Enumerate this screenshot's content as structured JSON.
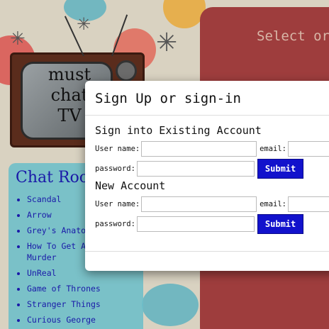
{
  "logo": {
    "line1": "must",
    "line2": "chat",
    "line3": "TV"
  },
  "rooms": {
    "title": "Chat Rooms",
    "items": [
      "Scandal",
      "Arrow",
      "Grey's Anatomy",
      "How To Get Away With Murder",
      "UnReal",
      "Game of Thrones",
      "Stranger Things",
      "Curious George"
    ]
  },
  "right_panel": {
    "heading": "Select or"
  },
  "modal": {
    "title": "Sign Up or sign-in",
    "signin": {
      "title": "Sign into Existing Account",
      "username_label": "User name:",
      "email_label": "email:",
      "password_label": "password:",
      "submit_label": "Submit"
    },
    "signup": {
      "title": "New Account",
      "username_label": "User name:",
      "email_label": "email:",
      "password_label": "password:",
      "submit_label": "Submit"
    }
  },
  "colors": {
    "rooms_panel": "#6cbec8",
    "right_panel": "#9e3d3d",
    "submit_button": "#1212cc"
  }
}
